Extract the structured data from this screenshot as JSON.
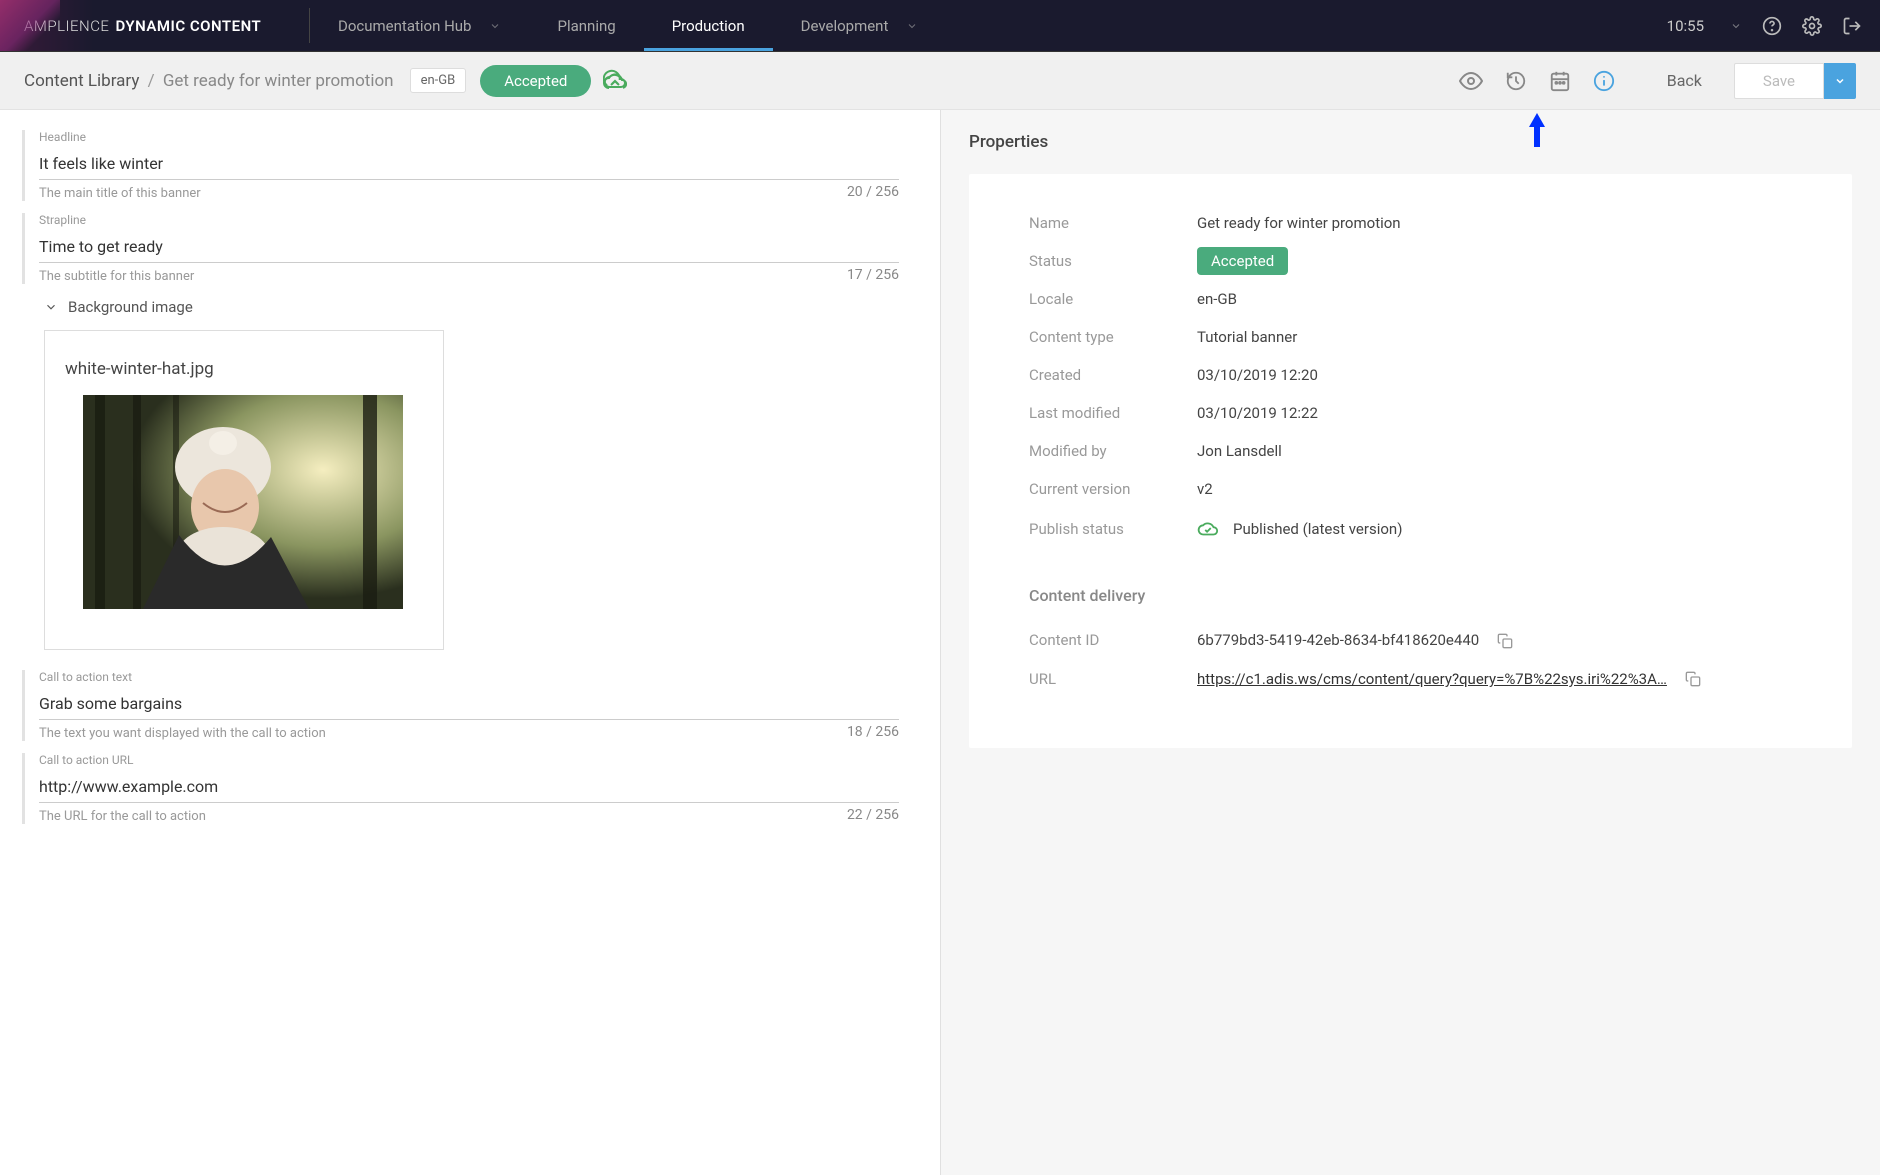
{
  "brand": {
    "light": "AMPLIENCE",
    "bold": "DYNAMIC CONTENT"
  },
  "nav": {
    "items": [
      {
        "label": "Documentation Hub",
        "dropdown": true,
        "active": false
      },
      {
        "label": "Planning",
        "dropdown": false,
        "active": false
      },
      {
        "label": "Production",
        "dropdown": false,
        "active": true
      },
      {
        "label": "Development",
        "dropdown": true,
        "active": false
      }
    ],
    "time": "10:55"
  },
  "subheader": {
    "crumb_root": "Content Library",
    "crumb_sep": "/",
    "crumb_current": "Get ready for winter promotion",
    "locale": "en-GB",
    "status": "Accepted",
    "back": "Back",
    "save": "Save"
  },
  "form": {
    "headline": {
      "label": "Headline",
      "value": "It feels like winter",
      "help": "The main title of this banner",
      "count": "20 / 256"
    },
    "strapline": {
      "label": "Strapline",
      "value": "Time to get ready",
      "help": "The subtitle for this banner",
      "count": "17 / 256"
    },
    "bgimage": {
      "section": "Background image",
      "filename": "white-winter-hat.jpg"
    },
    "cta_text": {
      "label": "Call to action text",
      "value": "Grab some bargains",
      "help": "The text you want displayed with the call to action",
      "count": "18 / 256"
    },
    "cta_url": {
      "label": "Call to action URL",
      "value": "http://www.example.com",
      "help": "The URL for the call to action",
      "count": "22 / 256"
    }
  },
  "properties": {
    "title": "Properties",
    "rows": {
      "name": {
        "label": "Name",
        "value": "Get ready for winter promotion"
      },
      "status": {
        "label": "Status",
        "value": "Accepted"
      },
      "locale": {
        "label": "Locale",
        "value": "en-GB"
      },
      "content_type": {
        "label": "Content type",
        "value": "Tutorial banner"
      },
      "created": {
        "label": "Created",
        "value": "03/10/2019 12:20"
      },
      "modified": {
        "label": "Last modified",
        "value": "03/10/2019 12:22"
      },
      "modified_by": {
        "label": "Modified by",
        "value": "Jon Lansdell"
      },
      "version": {
        "label": "Current version",
        "value": "v2"
      },
      "publish": {
        "label": "Publish status",
        "value": "Published (latest version)"
      }
    },
    "delivery": {
      "title": "Content delivery",
      "content_id": {
        "label": "Content ID",
        "value": "6b779bd3-5419-42eb-8634-bf418620e440"
      },
      "url": {
        "label": "URL",
        "value": "https://c1.adis.ws/cms/content/query?query=%7B%22sys.iri%22%3A…"
      }
    }
  }
}
